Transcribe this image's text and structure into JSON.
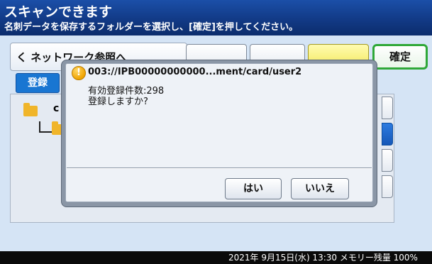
{
  "header": {
    "title": "スキャンできます",
    "instruction": "名刺データを保存するフォルダーを選択し、[確定]を押してください。"
  },
  "toolbar": {
    "breadcrumb": "く ネットワーク参照へ",
    "confirm_label": "確定"
  },
  "list": {
    "register_label": "登録",
    "row1_label": "c"
  },
  "dialog": {
    "title": "003://IPB00000000000...ment/card/user2",
    "message_count": "有効登録件数:298",
    "message_question": "登録しますか?",
    "yes_label": "はい",
    "no_label": "いいえ"
  },
  "status": {
    "text": "2021年 9月15日(水) 13:30 メモリー残量 100%"
  },
  "colors": {
    "header_bg": "#123a86",
    "accent_green": "#2fa838",
    "accent_yellow": "#f3e85a",
    "warning_icon": "#f0a400"
  }
}
